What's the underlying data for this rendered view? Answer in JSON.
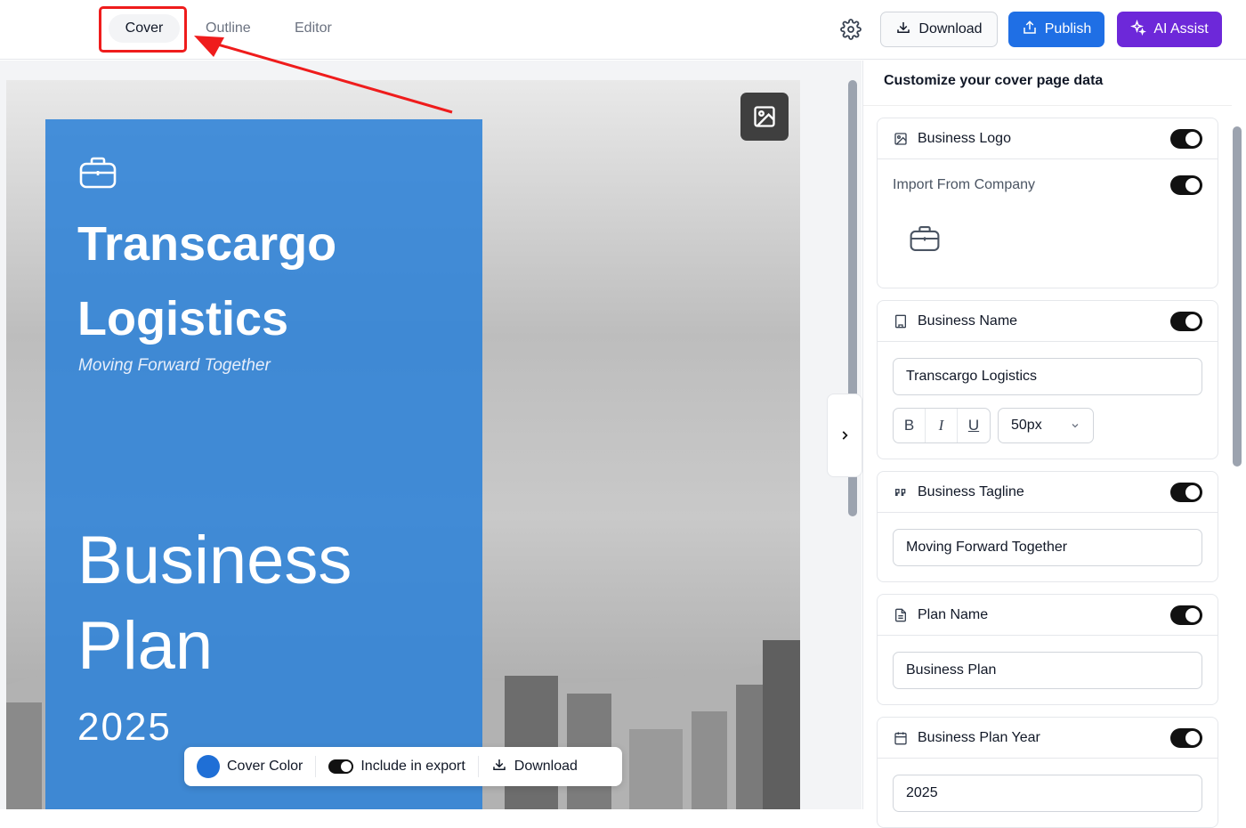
{
  "tabs": [
    {
      "label": "Cover",
      "active": true
    },
    {
      "label": "Outline",
      "active": false
    },
    {
      "label": "Editor",
      "active": false
    }
  ],
  "toolbar": {
    "settings_icon": "gear-icon",
    "download_label": "Download",
    "publish_label": "Publish",
    "ai_label": "AI Assist"
  },
  "cover": {
    "business_name": "Transcargo Logistics",
    "tagline": "Moving Forward Together",
    "plan_name": "Business Plan",
    "year": "2025",
    "panel_color": "#2d82d7"
  },
  "floatbar": {
    "cover_color_label": "Cover Color",
    "include_label": "Include in export",
    "download_label": "Download",
    "cover_color": "#1f6fd6"
  },
  "sidebar": {
    "title": "Customize your cover page data",
    "logo": {
      "label": "Business Logo",
      "enabled": true,
      "import_label": "Import From Company",
      "import_enabled": true
    },
    "name": {
      "label": "Business Name",
      "enabled": true,
      "value": "Transcargo Logistics",
      "font_size": "50px"
    },
    "tagline": {
      "label": "Business Tagline",
      "enabled": true,
      "value": "Moving Forward Together"
    },
    "plan": {
      "label": "Plan Name",
      "enabled": true,
      "value": "Business Plan"
    },
    "year": {
      "label": "Business Plan Year",
      "enabled": true,
      "value": "2025"
    }
  },
  "colors": {
    "publish": "#1f6fe5",
    "ai_assist": "#6d28d9",
    "highlight": "#ef1c1c"
  }
}
